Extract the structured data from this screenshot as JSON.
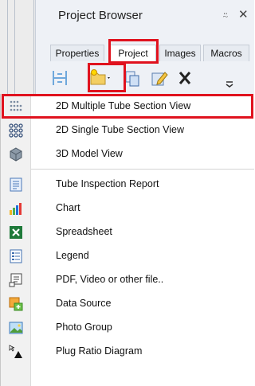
{
  "panel": {
    "title": "Project Browser",
    "pin_glyph": "⍨",
    "close_glyph": "✕",
    "tabs": [
      {
        "label": "Properties"
      },
      {
        "label": "Project"
      },
      {
        "label": "Images"
      },
      {
        "label": "Macros"
      }
    ],
    "active_tab": "Project",
    "toolbar_icons": [
      "section-layout-icon",
      "new-item-dropdown-icon",
      "copy-icon",
      "edit-icon",
      "delete-icon",
      "overflow-icon"
    ]
  },
  "menu": {
    "items": [
      {
        "label": "2D Multiple Tube Section View",
        "icon": "tube-grid-icon",
        "highlighted": true
      },
      {
        "label": "2D Single Tube Section View",
        "icon": "tube-single-icon"
      },
      {
        "label": "3D Model View",
        "icon": "cube-icon"
      },
      {
        "label": "Tube Inspection Report",
        "icon": "report-icon"
      },
      {
        "label": "Chart",
        "icon": "bar-chart-icon"
      },
      {
        "label": "Spreadsheet",
        "icon": "spreadsheet-icon"
      },
      {
        "label": "Legend",
        "icon": "legend-icon"
      },
      {
        "label": "PDF, Video or other file..",
        "icon": "file-icon"
      },
      {
        "label": "Data Source",
        "icon": "data-source-icon"
      },
      {
        "label": "Photo Group",
        "icon": "photo-icon"
      },
      {
        "label": "Plug Ratio Diagram",
        "icon": "plug-ratio-icon"
      }
    ]
  },
  "colors": {
    "highlight": "#e0121e",
    "panel_bg": "#eef1f6",
    "gutter_bg": "#f1f1f1"
  }
}
